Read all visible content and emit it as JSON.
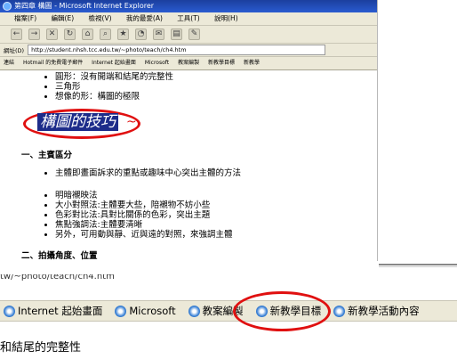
{
  "window": {
    "title": "第四章 構圖 - Microsoft Internet Explorer"
  },
  "menu": [
    "檔案(F)",
    "編輯(E)",
    "檢視(V)",
    "我的最愛(A)",
    "工具(T)",
    "說明(H)"
  ],
  "address": {
    "label": "網址(D)",
    "value": "http://student.nhsh.tcc.edu.tw/~photo/teach/ch4.htm"
  },
  "links_small": [
    "連結",
    "Hotmail 的免費電子郵件",
    "Internet 起始畫面",
    "Microsoft",
    "教案編製",
    "新教學目標",
    "新教學"
  ],
  "content": {
    "top_list": [
      "圓形：沒有開端和結尾的完整性",
      "三角形",
      "想像的形：構圖的極限"
    ],
    "big_title": "構圖的技巧",
    "tilde": "~",
    "section1": "一、主賓區分",
    "section1_list": [
      "主體即畫面訴求的重點或趣味中心突出主體的方法"
    ],
    "section1_list2": [
      "明暗襯映法",
      "大小對照法:主體要大些，陪襯物不妨小些",
      "色彩對比法:具對比關係的色彩，突出主題",
      "焦點強調法:主體要清晰",
      "另外，可用動與靜、近與遠的對照，來強調主體"
    ],
    "section2": "二、拍攝角度、位置"
  },
  "fragment": {
    "url": "tw/~photo/teach/ch4.htm",
    "links": [
      "Internet 起始畫面",
      "Microsoft",
      "教案編製",
      "新教學目標",
      "新教學活動內容"
    ],
    "bottom_text": "和結尾的完整性"
  },
  "colors": {
    "annotation_red": "#e01010",
    "title_bg": "#1d2c8a",
    "chrome_bg": "#ece9d8"
  }
}
